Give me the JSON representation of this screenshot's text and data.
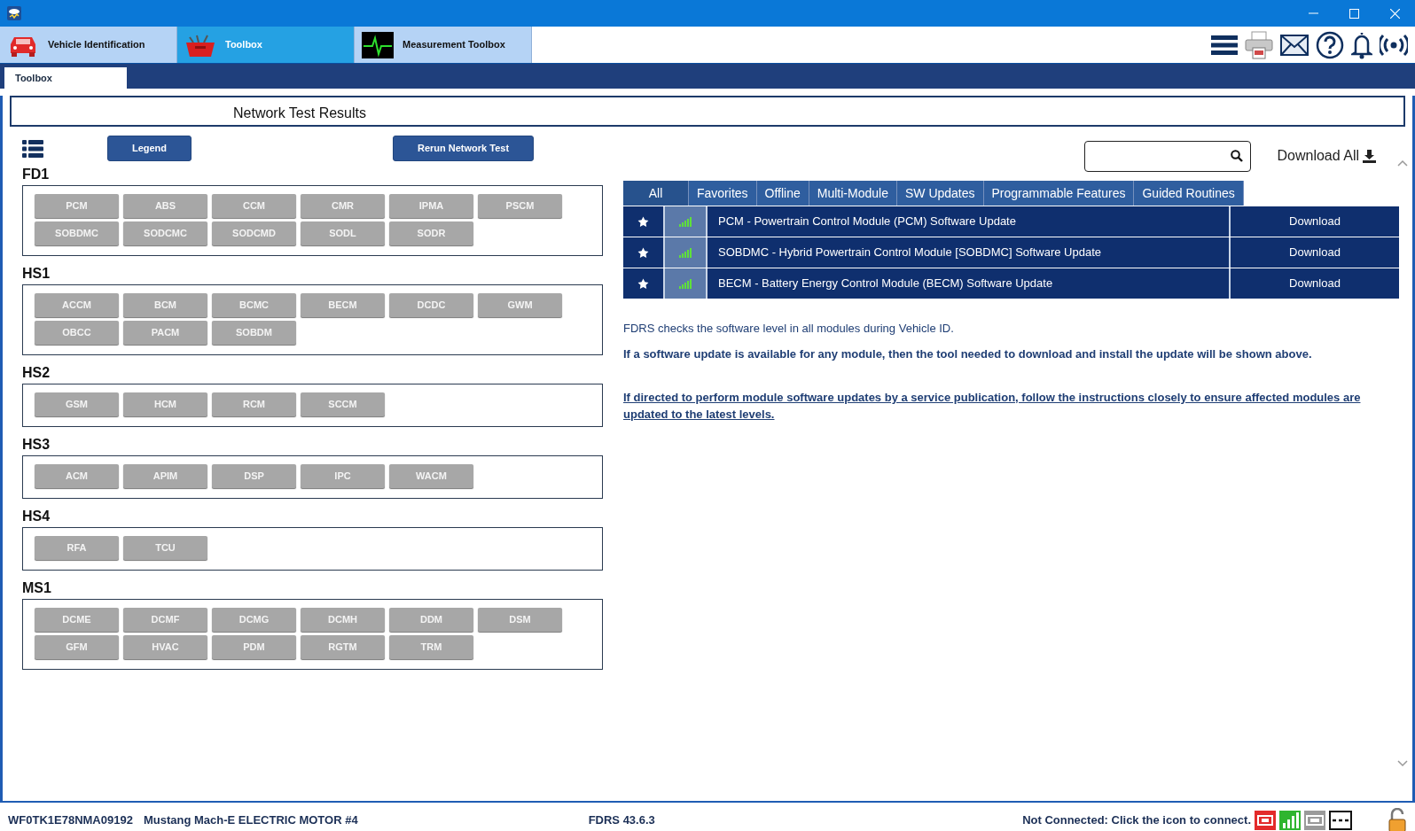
{
  "app_tabs": [
    {
      "label": "Vehicle Identification",
      "kind": "car",
      "selected": false
    },
    {
      "label": "Toolbox",
      "kind": "toolbox",
      "selected": true
    },
    {
      "label": "Measurement Toolbox",
      "kind": "scope",
      "selected": false
    }
  ],
  "sub_tabs": [
    {
      "label": "Toolbox",
      "selected": true
    }
  ],
  "panel_title": "Network Test Results",
  "toolbar": {
    "legend_button": "Legend",
    "rerun_button": "Rerun Network Test"
  },
  "networks": [
    {
      "name": "FD1",
      "modules": [
        "PCM",
        "ABS",
        "CCM",
        "CMR",
        "IPMA",
        "PSCM",
        "SOBDMC",
        "SODCMC",
        "SODCMD",
        "SODL",
        "SODR"
      ]
    },
    {
      "name": "HS1",
      "modules": [
        "ACCM",
        "BCM",
        "BCMC",
        "BECM",
        "DCDC",
        "GWM",
        "OBCC",
        "PACM",
        "SOBDM"
      ]
    },
    {
      "name": "HS2",
      "modules": [
        "GSM",
        "HCM",
        "RCM",
        "SCCM"
      ]
    },
    {
      "name": "HS3",
      "modules": [
        "ACM",
        "APIM",
        "DSP",
        "IPC",
        "WACM"
      ]
    },
    {
      "name": "HS4",
      "modules": [
        "RFA",
        "TCU"
      ]
    },
    {
      "name": "MS1",
      "modules": [
        "DCME",
        "DCMF",
        "DCMG",
        "DCMH",
        "DDM",
        "DSM",
        "GFM",
        "HVAC",
        "PDM",
        "RGTM",
        "TRM"
      ]
    }
  ],
  "download_all": "Download All",
  "filter_tabs": [
    {
      "label": "All",
      "selected": true
    },
    {
      "label": "Favorites",
      "selected": false
    },
    {
      "label": "Offline",
      "selected": false
    },
    {
      "label": "Multi-Module",
      "selected": false
    },
    {
      "label": "SW Updates",
      "selected": false
    },
    {
      "label": "Programmable Features",
      "selected": false
    },
    {
      "label": "Guided Routines",
      "selected": false
    }
  ],
  "updates": [
    {
      "title": "PCM - Powertrain Control Module (PCM) Software Update",
      "action": "Download"
    },
    {
      "title": "SOBDMC - Hybrid Powertrain Control Module [SOBDMC] Software Update",
      "action": "Download"
    },
    {
      "title": "BECM - Battery Energy Control Module (BECM) Software Update",
      "action": "Download"
    }
  ],
  "info": [
    {
      "kind": "plain",
      "text": "FDRS checks the software level in all modules during Vehicle ID."
    },
    {
      "kind": "bold",
      "text": "If a software update is available for any module, then the tool needed to download and install the update will be shown above."
    },
    {
      "kind": "link",
      "text": "If directed to perform module software updates by a service publication, follow the instructions closely to ensure affected modules are updated to the latest levels."
    }
  ],
  "status_bar": {
    "vin": "WF0TK1E78NMA09192",
    "vehicle": "Mustang Mach-E ELECTRIC MOTOR #4",
    "version": "FDRS 43.6.3",
    "connection": "Not Connected: Click the icon to connect."
  }
}
